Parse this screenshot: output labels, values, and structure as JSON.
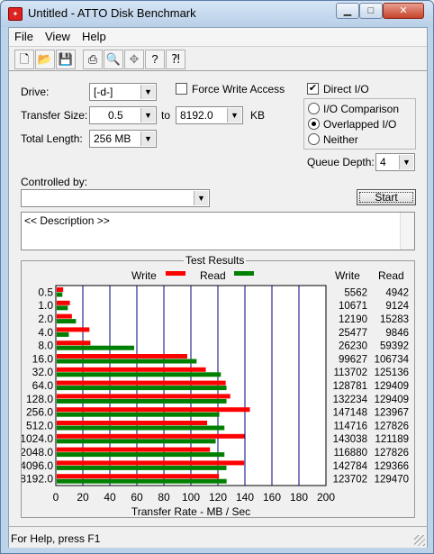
{
  "window": {
    "title": "Untitled - ATTO Disk Benchmark",
    "icon": "atto-app-icon"
  },
  "menu": [
    "File",
    "View",
    "Help"
  ],
  "toolbar": [
    "new-icon",
    "open-icon",
    "save-icon",
    "print-icon",
    "print-preview-icon",
    "move-icon",
    "help-icon",
    "context-help-icon"
  ],
  "settings": {
    "drive_label": "Drive:",
    "drive_value": "[-d-]",
    "force_write_label": "Force Write Access",
    "force_write_checked": false,
    "direct_io_label": "Direct I/O",
    "direct_io_checked": true,
    "transfer_size_label": "Transfer Size:",
    "transfer_from": "0.5",
    "to_label": "to",
    "transfer_to": "8192.0",
    "kb_label": "KB",
    "total_length_label": "Total Length:",
    "total_length_value": "256 MB",
    "io_comparison_label": "I/O Comparison",
    "overlapped_io_label": "Overlapped I/O",
    "neither_label": "Neither",
    "selected_mode": "Overlapped I/O",
    "queue_depth_label": "Queue Depth:",
    "queue_depth_value": "4",
    "controlled_by_label": "Controlled by:",
    "controlled_by_value": "",
    "start_label": "Start",
    "description": "<< Description >>"
  },
  "results": {
    "title": "Test Results",
    "write_legend": "Write",
    "read_legend": "Read",
    "write_col": "Write",
    "read_col": "Read"
  },
  "colors": {
    "write": "#ff0000",
    "read": "#008000",
    "grid": "#00007f"
  },
  "chart_data": {
    "type": "bar",
    "orientation": "horizontal",
    "categories": [
      "0.5",
      "1.0",
      "2.0",
      "4.0",
      "8.0",
      "16.0",
      "32.0",
      "64.0",
      "128.0",
      "256.0",
      "512.0",
      "1024.0",
      "2048.0",
      "4096.0",
      "8192.0"
    ],
    "series": [
      {
        "name": "Write",
        "values": [
          5562,
          10671,
          12190,
          25477,
          26230,
          99627,
          113702,
          128781,
          132234,
          147148,
          114716,
          143038,
          116880,
          142784,
          123702
        ]
      },
      {
        "name": "Read",
        "values": [
          4942,
          9124,
          15283,
          9846,
          59392,
          106734,
          125136,
          129409,
          129409,
          123967,
          127826,
          121189,
          127826,
          129366,
          129470
        ]
      }
    ],
    "xlabel": "Transfer Rate - MB / Sec",
    "ylabel": "",
    "xticks": [
      "0",
      "20",
      "40",
      "60",
      "80",
      "100",
      "120",
      "140",
      "160",
      "180",
      "200"
    ],
    "xlim": [
      0,
      200
    ],
    "value_unit": "KB/s",
    "legend": "top",
    "grid": true
  },
  "status": "For Help, press F1"
}
